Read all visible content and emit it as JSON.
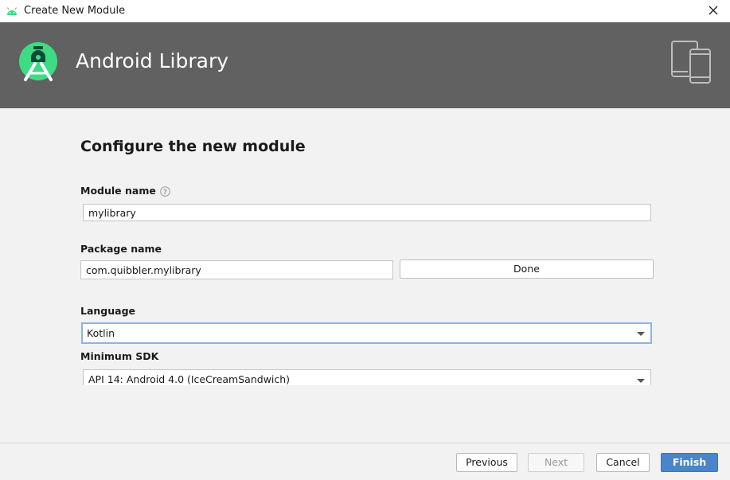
{
  "window": {
    "title": "Create New Module",
    "close_icon": "close-icon",
    "app_icon": "android-icon"
  },
  "banner": {
    "title": "Android Library",
    "logo_icon": "android-studio-logo-icon",
    "devices_icon": "tablet-phone-icon",
    "background": "#616161"
  },
  "form": {
    "heading": "Configure the new module",
    "module_name": {
      "label": "Module name",
      "value": "mylibrary",
      "help_icon": "help-icon"
    },
    "package_name": {
      "label": "Package name",
      "value": "com.quibbler.mylibrary",
      "button": "Done"
    },
    "language": {
      "label": "Language",
      "selected": "Kotlin"
    },
    "minimum_sdk": {
      "label": "Minimum SDK",
      "selected": "API 14: Android 4.0 (IceCreamSandwich)"
    }
  },
  "footer": {
    "previous": "Previous",
    "next": "Next",
    "cancel": "Cancel",
    "finish": "Finish",
    "accent": "#4a84c9"
  }
}
